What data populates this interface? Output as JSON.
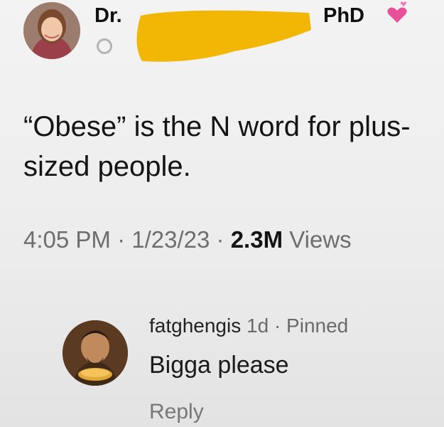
{
  "tweet": {
    "author_prefix": "Dr.",
    "author_suffix": "PhD",
    "text": "“Obese” is the N word for plus-sized people.",
    "time": "4:05 PM",
    "date": "1/23/23",
    "views_count": "2.3M",
    "views_label": "Views",
    "separator": "·"
  },
  "comment": {
    "username": "fatghengis",
    "age": "1d",
    "separator": "·",
    "pinned_label": "Pinned",
    "text": "Bigga please",
    "reply_label": "Reply"
  },
  "colors": {
    "redaction": "#f2b705",
    "heart": "#e8509a"
  }
}
